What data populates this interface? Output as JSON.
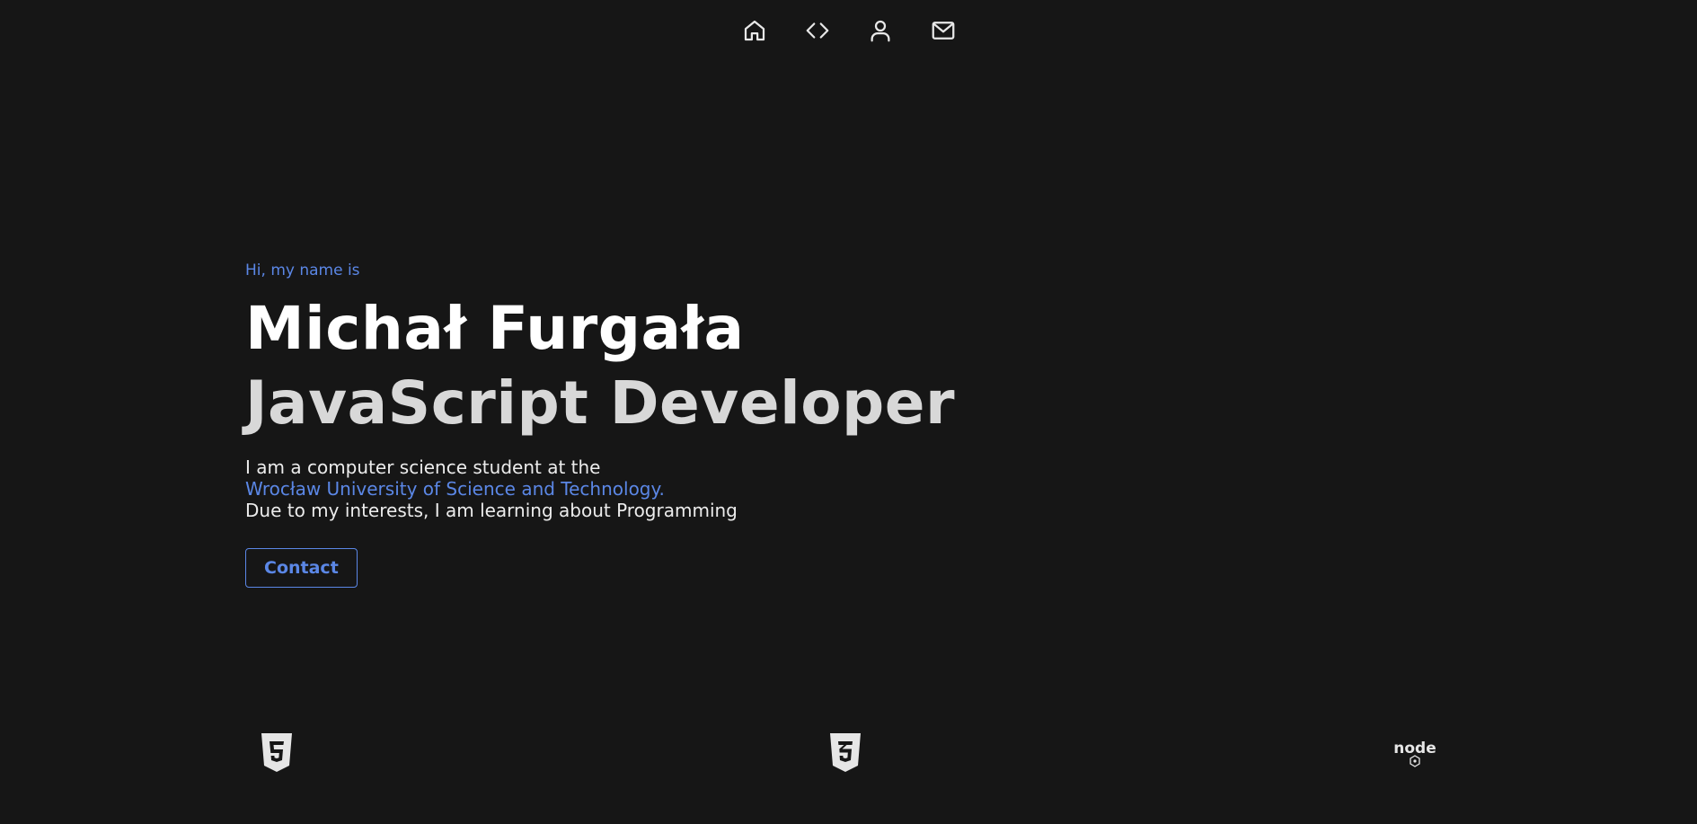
{
  "nav": {
    "items": [
      {
        "icon": "home-icon"
      },
      {
        "icon": "code-icon"
      },
      {
        "icon": "user-icon"
      },
      {
        "icon": "mail-icon"
      }
    ]
  },
  "hero": {
    "greeting": "Hi, my name is",
    "name": "Michał Furgała",
    "role": "JavaScript Developer",
    "bio_line1": "I am a computer science student at the",
    "bio_link": "Wrocław University of Science and Technology.",
    "bio_line3": "Due to my interests, I am learning about Programming",
    "contact_label": "Contact"
  },
  "tech": {
    "items": [
      {
        "icon": "html5-icon"
      },
      {
        "icon": "css3-icon"
      },
      {
        "icon": "nodejs-icon",
        "label": "node"
      }
    ]
  },
  "colors": {
    "background": "#161616",
    "accent": "#5b87e6",
    "heading": "#ffffff",
    "subheading": "#d8d8d8"
  }
}
